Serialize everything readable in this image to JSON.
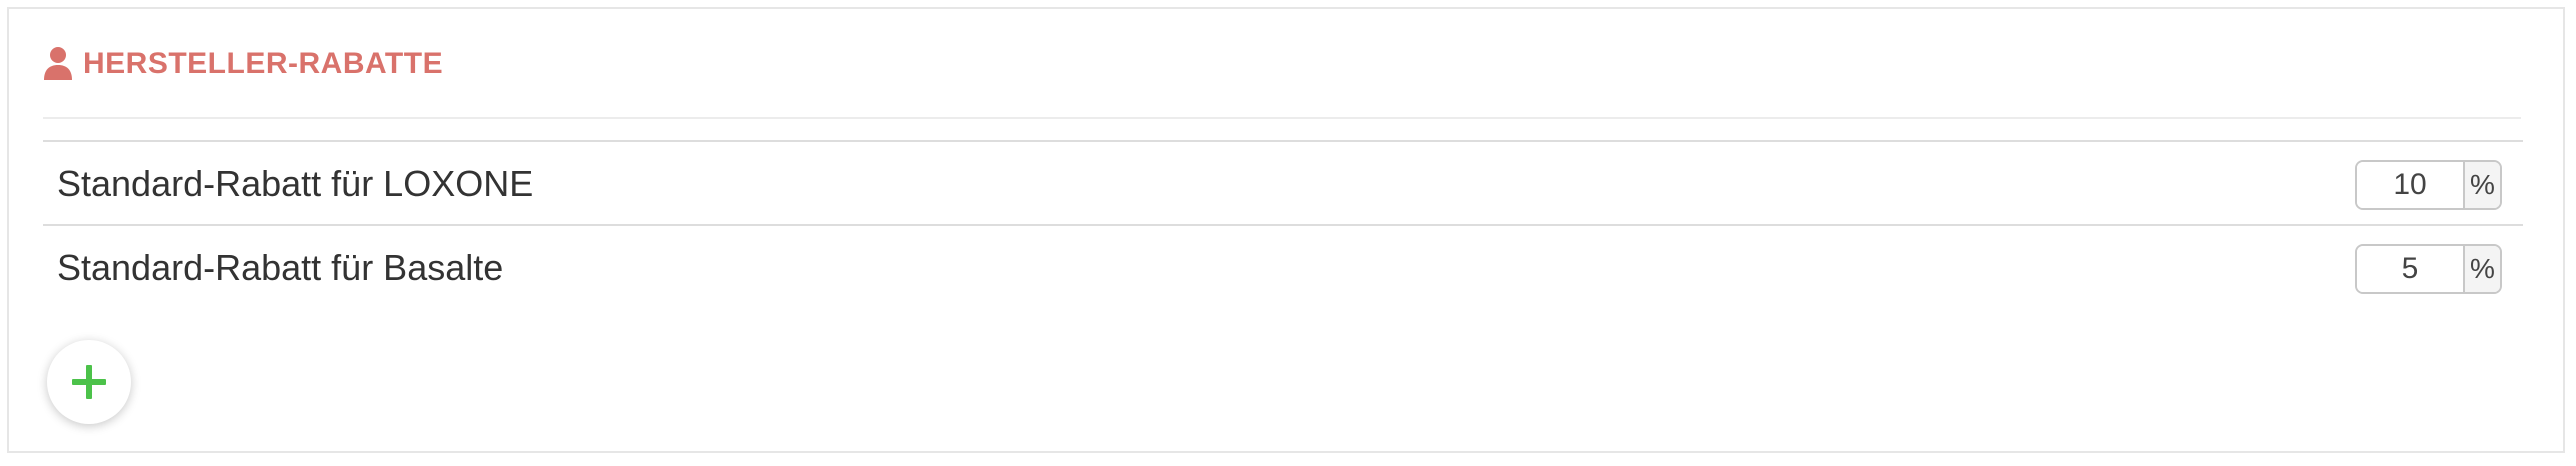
{
  "section": {
    "title": "HERSTELLER-RABATTE",
    "icon": "user-icon",
    "accent_color": "#d9726b"
  },
  "discounts": [
    {
      "label": "Standard-Rabatt für LOXONE",
      "value": "10",
      "unit": "%"
    },
    {
      "label": "Standard-Rabatt für Basalte",
      "value": "5",
      "unit": "%"
    }
  ],
  "add_button": {
    "icon": "plus-icon",
    "color": "#4cc24a"
  }
}
